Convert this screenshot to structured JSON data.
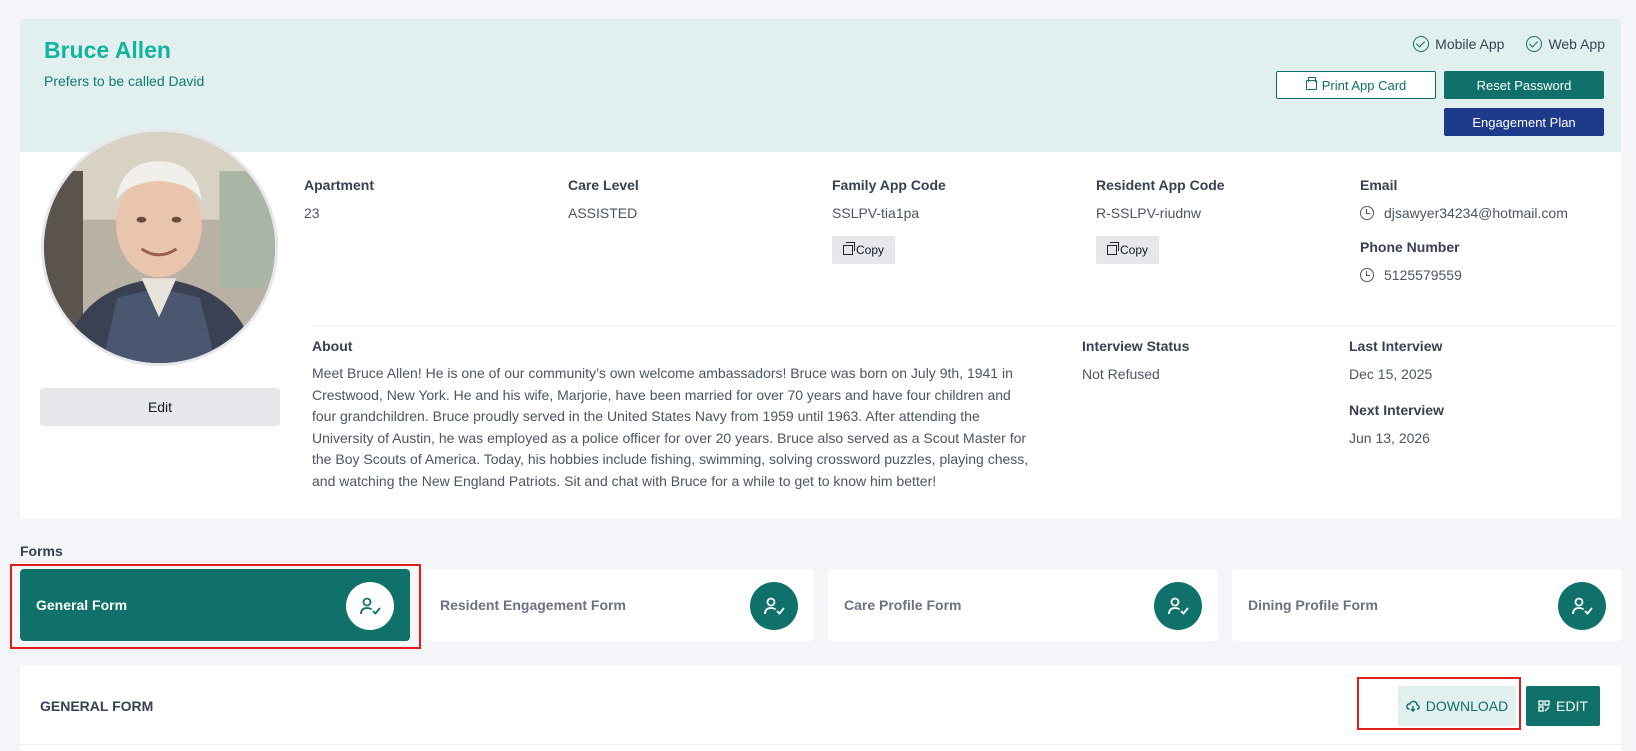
{
  "resident": {
    "name": "Bruce Allen",
    "nickname": "Prefers to be called David"
  },
  "app_flags": [
    {
      "label": "Mobile App",
      "icon": "check-circle-icon"
    },
    {
      "label": "Web App",
      "icon": "check-circle-icon"
    }
  ],
  "header_buttons": {
    "print": "Print App Card",
    "reset": "Reset Password",
    "plan": "Engagement Plan"
  },
  "profile": {
    "edit_label": "Edit",
    "apartment": {
      "label": "Apartment",
      "value": "23"
    },
    "care_level": {
      "label": "Care Level",
      "value": "ASSISTED"
    },
    "family_code": {
      "label": "Family App Code",
      "value": "SSLPV-tia1pa",
      "copy": "Copy"
    },
    "resident_code": {
      "label": "Resident App Code",
      "value": "R-SSLPV-riudnw",
      "copy": "Copy"
    },
    "email": {
      "label": "Email",
      "value": "djsawyer34234@hotmail.com"
    },
    "phone": {
      "label": "Phone Number",
      "value": "5125579559"
    },
    "about": {
      "label": "About",
      "text": "Meet Bruce Allen! He is one of our community’s own welcome ambassadors! Bruce was born on July 9th, 1941 in Crestwood, New York. He and his wife, Marjorie, have been married for over 70 years and have four children and four grandchildren. Bruce proudly served in the United States Navy from 1959 until 1963. After attending the University of Austin, he was employed as a police officer for over 20 years. Bruce also served as a Scout Master for the Boy Scouts of America. Today, his hobbies include fishing, swimming, solving crossword puzzles, playing chess, and watching the New England Patriots. Sit and chat with Bruce for a while to get to know him better!"
    },
    "interview_status": {
      "label": "Interview Status",
      "value": "Not Refused"
    },
    "last_interview": {
      "label": "Last Interview",
      "value": "Dec 15, 2025"
    },
    "next_interview": {
      "label": "Next Interview",
      "value": "Jun 13, 2026"
    }
  },
  "forms": {
    "title": "Forms",
    "tabs": [
      {
        "label": "General Form",
        "active": true
      },
      {
        "label": "Resident Engagement Form",
        "active": false
      },
      {
        "label": "Care Profile Form",
        "active": false
      },
      {
        "label": "Dining Profile Form",
        "active": false
      }
    ]
  },
  "general_form": {
    "title": "GENERAL FORM",
    "download": "DOWNLOAD",
    "edit": "EDIT"
  },
  "colors": {
    "primary": "#0f7169",
    "accent_text": "#14b39d",
    "header_bg": "#e1f0ef",
    "navy": "#1e3a8a",
    "highlight": "#e11d1d"
  }
}
